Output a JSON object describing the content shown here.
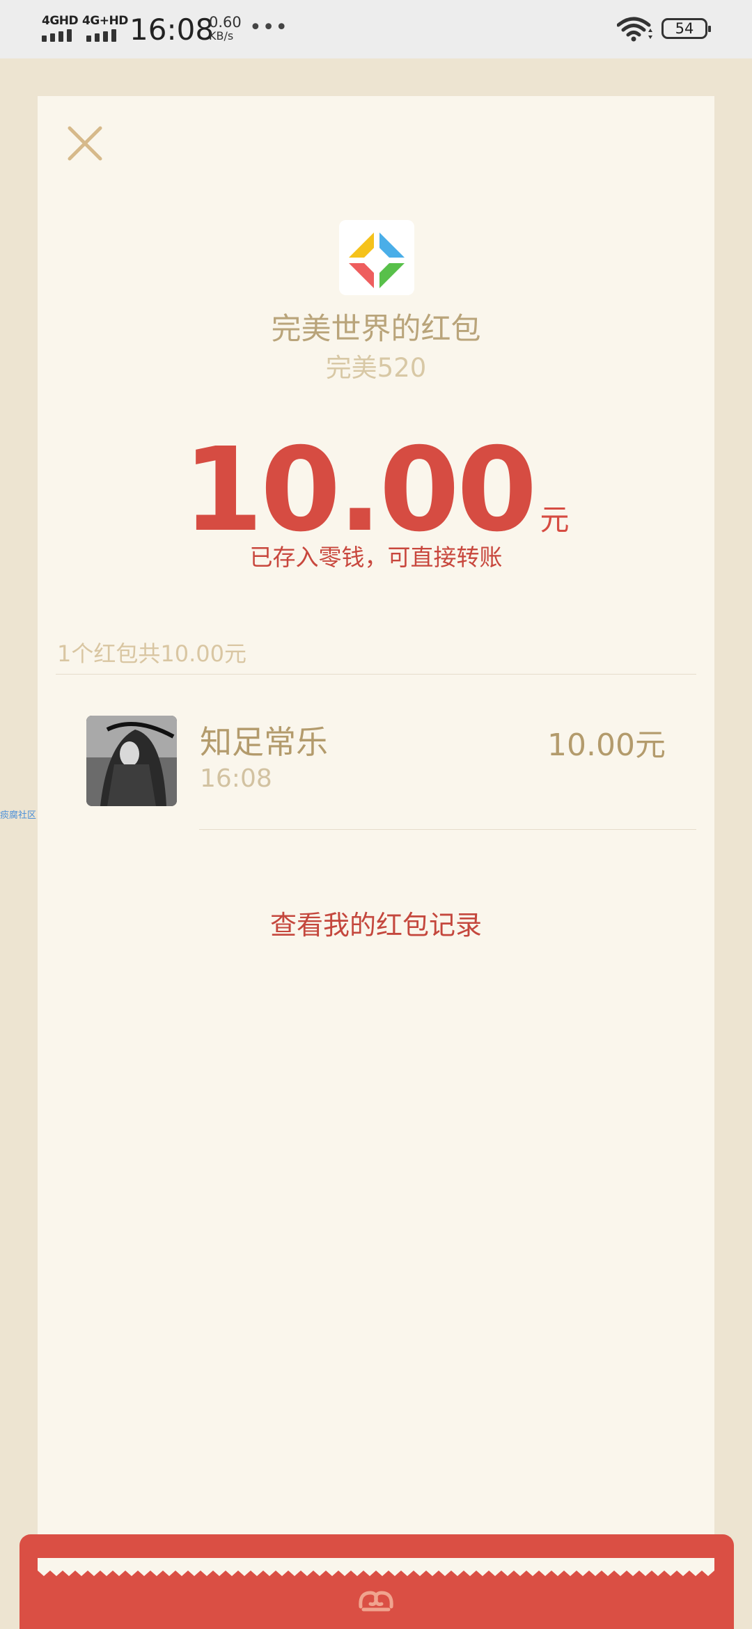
{
  "status_bar": {
    "signal1_label": "4GHD",
    "signal2_label": "4G+HD",
    "time": "16:08",
    "net_speed_value": "0.60",
    "net_speed_unit": "KB/s",
    "more_dots": "•••",
    "battery_level": "54"
  },
  "header": {
    "sender_title": "完美世界的红包",
    "greeting": "完美520"
  },
  "amount": {
    "value": "10.00",
    "unit": "元",
    "note": "已存入零钱，可直接转账"
  },
  "summary": {
    "text": "1个红包共10.00元"
  },
  "records": [
    {
      "name": "知足常乐",
      "time": "16:08",
      "amount": "10.00元"
    }
  ],
  "links": {
    "view_records": "查看我的红包记录"
  },
  "watermark": {
    "text": "痰腐社区"
  },
  "colors": {
    "amount_red": "#d64c42",
    "gold_text": "#b39b6c",
    "card_bg": "#faf6ec",
    "page_bg": "#ede4d1",
    "flap_red": "#da4f44"
  },
  "icons": {
    "close": "close-icon",
    "logo": "perfect-world-logo",
    "flap": "cloud-pattern-icon",
    "wifi": "wifi-icon",
    "battery": "battery-icon"
  }
}
